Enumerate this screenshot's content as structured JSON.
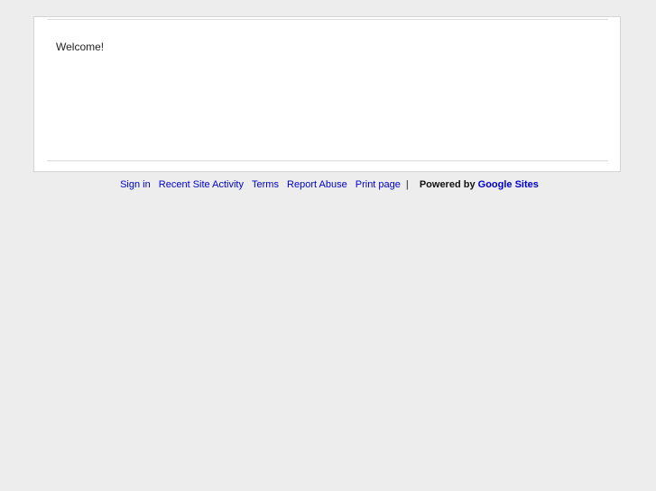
{
  "content": {
    "welcome_text": "Welcome!"
  },
  "footer": {
    "sign_in": "Sign in",
    "recent_site_activity": "Recent Site Activity",
    "terms": "Terms",
    "report_abuse": "Report Abuse",
    "print_page": "Print page",
    "separator": "|",
    "powered_by": "Powered by",
    "google_sites": "Google Sites"
  },
  "colors": {
    "page_background": "#ededed",
    "card_background": "#ffffff",
    "link": "#0000cc"
  }
}
